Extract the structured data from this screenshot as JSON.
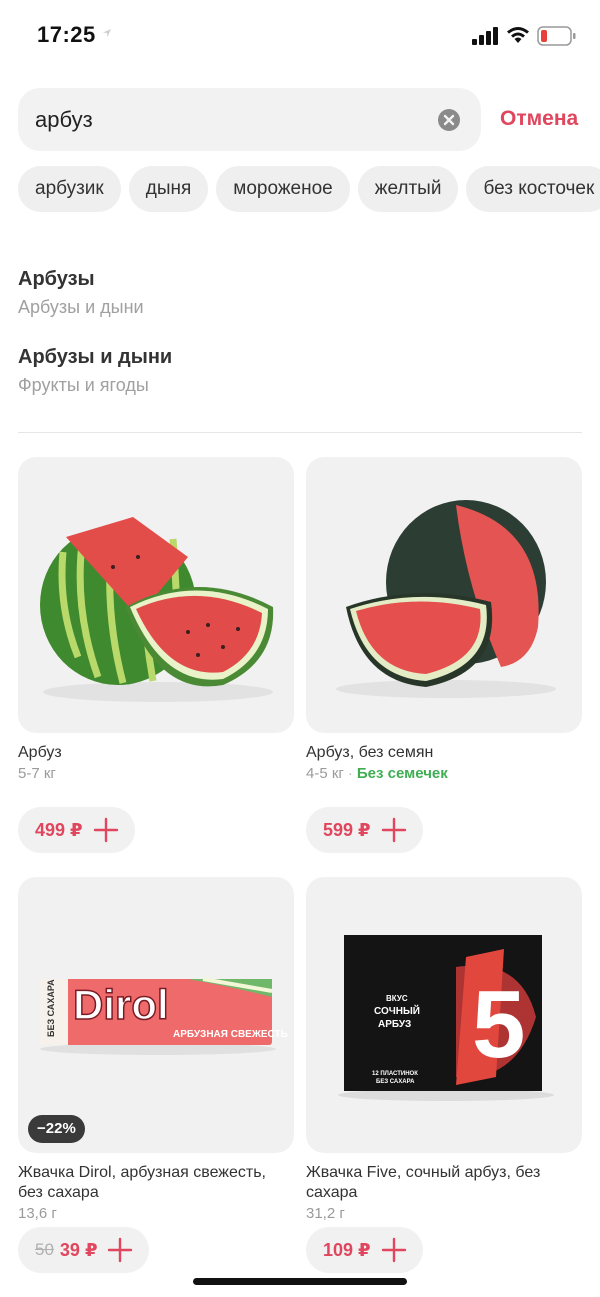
{
  "status": {
    "time": "17:25"
  },
  "search": {
    "value": "арбуз",
    "cancel_label": "Отмена"
  },
  "chips": [
    "арбузик",
    "дыня",
    "мороженое",
    "желтый",
    "без косточек"
  ],
  "suggestions": [
    {
      "title": "Арбузы",
      "subtitle": "Арбузы и дыни"
    },
    {
      "title": "Арбузы и дыни",
      "subtitle": "Фрукты и ягоды"
    }
  ],
  "products": [
    {
      "name": "Арбуз",
      "weight": "5-7 кг",
      "tag": "",
      "price": "499 ₽",
      "old_price": "",
      "discount": ""
    },
    {
      "name": "Арбуз, без семян",
      "weight": "4-5 кг",
      "tag": "Без семечек",
      "price": "599 ₽",
      "old_price": "",
      "discount": ""
    },
    {
      "name": "Жвачка Dirol, арбузная свежесть, без сахара",
      "weight": "13,6 г",
      "tag": "",
      "price": "39 ₽",
      "old_price": "50",
      "discount": "−22%"
    },
    {
      "name": "Жвачка Five, сочный арбуз, без сахара",
      "weight": "31,2 г",
      "tag": "",
      "price": "109 ₽",
      "old_price": "",
      "discount": ""
    }
  ],
  "packaging": {
    "dirol_brand": "Dirol",
    "dirol_flavor": "АРБУЗНАЯ СВЕЖЕСТЬ",
    "dirol_sugar": "БЕЗ САХАРА",
    "five_flavor_1": "ВКУС",
    "five_flavor_2": "СОЧНЫЙ",
    "five_flavor_3": "АРБУЗ",
    "five_count_1": "12 ПЛАСТИНОК",
    "five_count_2": "БЕЗ САХАРА"
  },
  "colors": {
    "accent": "#e0465d",
    "tag_green": "#3fae53",
    "chip_bg": "#f0efef"
  }
}
